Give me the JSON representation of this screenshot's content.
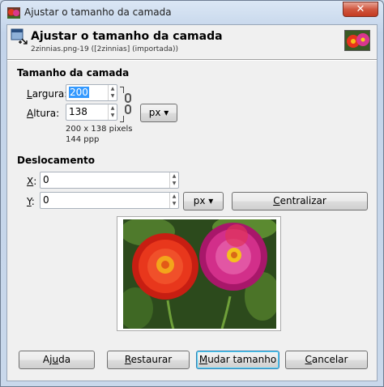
{
  "window": {
    "title": "Ajustar o tamanho da camada",
    "close_label": "✕"
  },
  "header": {
    "title": "Ajustar o tamanho da camada",
    "subtitle": "2zinnias.png-19 ([2zinnias] (importada))"
  },
  "layer_size": {
    "section_title": "Tamanho da camada",
    "width_label_mnemonic": "L",
    "width_label_rest": "argura:",
    "width_value": "200",
    "height_label_mnemonic": "A",
    "height_label_rest": "ltura:",
    "height_value": "138",
    "unit": "px",
    "dimensions_text": "200 x 138 pixels",
    "resolution_text": "144 ppp"
  },
  "offset": {
    "section_title": "Deslocamento",
    "x_label_mnemonic": "X",
    "x_label_rest": ":",
    "x_value": "0",
    "y_label_mnemonic": "Y",
    "y_label_rest": ":",
    "y_value": "0",
    "unit": "px",
    "center_button_mnemonic": "C",
    "center_button_rest": "entralizar"
  },
  "buttons": {
    "help_pre": "Aj",
    "help_mnemonic": "u",
    "help_post": "da",
    "reset_mnemonic": "R",
    "reset_rest": "estaurar",
    "resize_mnemonic": "M",
    "resize_rest": "udar tamanho",
    "cancel_mnemonic": "C",
    "cancel_rest": "ancelar"
  },
  "colors": {
    "selection": "#3399ff",
    "default_button_border": "#3c7fb1"
  }
}
